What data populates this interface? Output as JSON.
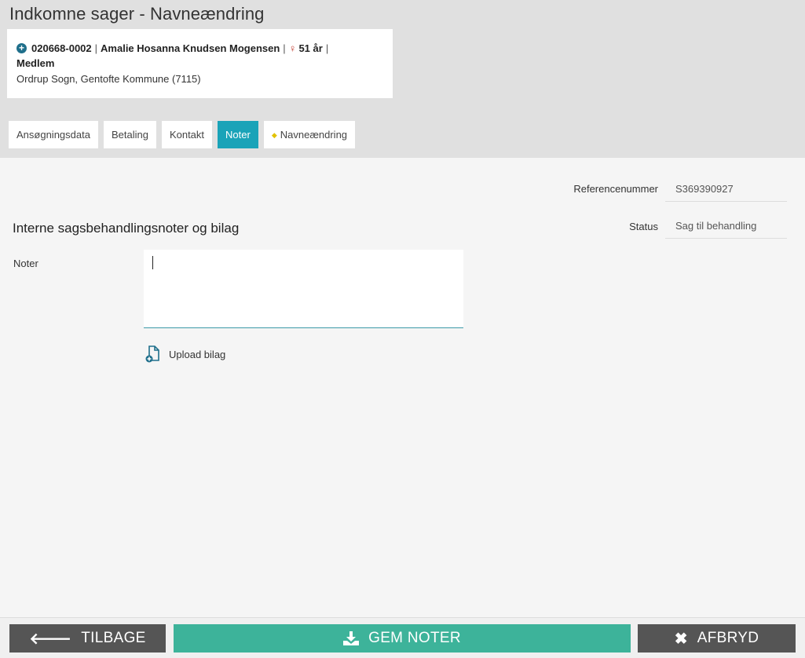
{
  "header": {
    "title": "Indkomne sager - Navneændring"
  },
  "person": {
    "cpr": "020668-0002",
    "name": "Amalie Hosanna Knudsen Mogensen",
    "age": "51 år",
    "membership": "Medlem",
    "location": "Ordrup Sogn, Gentofte Kommune (7115)"
  },
  "tabs": [
    {
      "label": "Ansøgningsdata"
    },
    {
      "label": "Betaling"
    },
    {
      "label": "Kontakt"
    },
    {
      "label": "Noter"
    },
    {
      "label": "Navneændring"
    }
  ],
  "info": {
    "ref_label": "Referencenummer",
    "ref_value": "S369390927",
    "status_label": "Status",
    "status_value": "Sag til behandling"
  },
  "main": {
    "section_title": "Interne sagsbehandlingsnoter og bilag",
    "notes_label": "Noter",
    "notes_value": "",
    "upload_label": "Upload bilag"
  },
  "footer": {
    "back_label": "TILBAGE",
    "save_label": "GEM NOTER",
    "cancel_label": "AFBRYD"
  },
  "colors": {
    "accent": "#1aa3b8",
    "save": "#3db39a",
    "dark_button": "#555555"
  }
}
